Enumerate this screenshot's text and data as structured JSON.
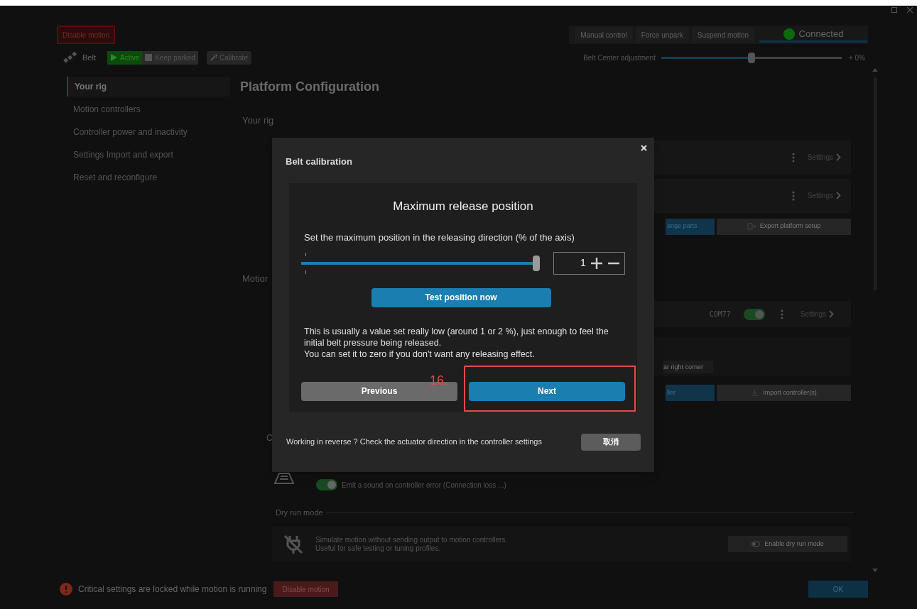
{
  "header": {
    "disable_motion": "Disable motion",
    "actions": [
      "Manual control",
      "Force unpark",
      "Suspend motion"
    ],
    "connection": {
      "label": "Connected",
      "connected": true
    }
  },
  "toolbar": {
    "device": "Belt",
    "modes": [
      {
        "label": "Active",
        "selected": true
      },
      {
        "label": "Keep parked",
        "selected": false
      }
    ],
    "calibrate": "Calibrate",
    "adjustment": {
      "label": "Belt Center adjustment",
      "level": 0.5,
      "reading": "+ 0%"
    }
  },
  "sidebar": {
    "items": [
      {
        "label": "Your rig",
        "selected": true
      },
      {
        "label": "Motion controllers",
        "selected": false
      },
      {
        "label": "Controller power and inactivity",
        "selected": false
      },
      {
        "label": "Settings Import and export",
        "selected": false
      },
      {
        "label": "Reset and reconfigure",
        "selected": false
      }
    ]
  },
  "main": {
    "title": "Platform Configuration",
    "rig_heading": "Your rig",
    "rig_rows": [
      {
        "action": "Settings"
      },
      {
        "action": "Settings"
      }
    ],
    "rig_buttons": [
      "ange parts",
      "Export platform setup"
    ],
    "motion_heading": "Motior",
    "controller_row": {
      "port": "COM77",
      "on": true,
      "action": "Settings"
    },
    "hint_fragment": "ar right corner",
    "controller_buttons": [
      "ller",
      "Import controller(s)"
    ],
    "sound_heading": "C",
    "sound_option": {
      "label": "Emit a sound on controller error (Connection loss ...)",
      "on": true
    },
    "dry_run": {
      "heading": "Dry run mode",
      "description": [
        "Simulate motion without sending output to motion controllers.",
        "Useful for safe testing or tuning profiles."
      ],
      "button": "Enable dry run mode"
    }
  },
  "footer": {
    "message": "Critical settings are locked while motion is running",
    "button": "Disable motion",
    "ok": "OK"
  },
  "dialog": {
    "title": "Belt calibration",
    "step_title": "Maximum release position",
    "prompt": "Set the maximum position in the releasing direction (% of the axis)",
    "slider": {
      "level": 1
    },
    "value": "1",
    "test_button": "Test position now",
    "help": [
      "This is usually a value set really low (around 1 or 2 %), just enough to feel the initial belt pressure being released.",
      "You can set it to zero if you don't want any releasing effect."
    ],
    "previous": "Previous",
    "next": "Next",
    "annotation": "16.",
    "reverse_hint": "Working in reverse ? Check the actuator direction in the controller settings",
    "cancel": "取消"
  }
}
